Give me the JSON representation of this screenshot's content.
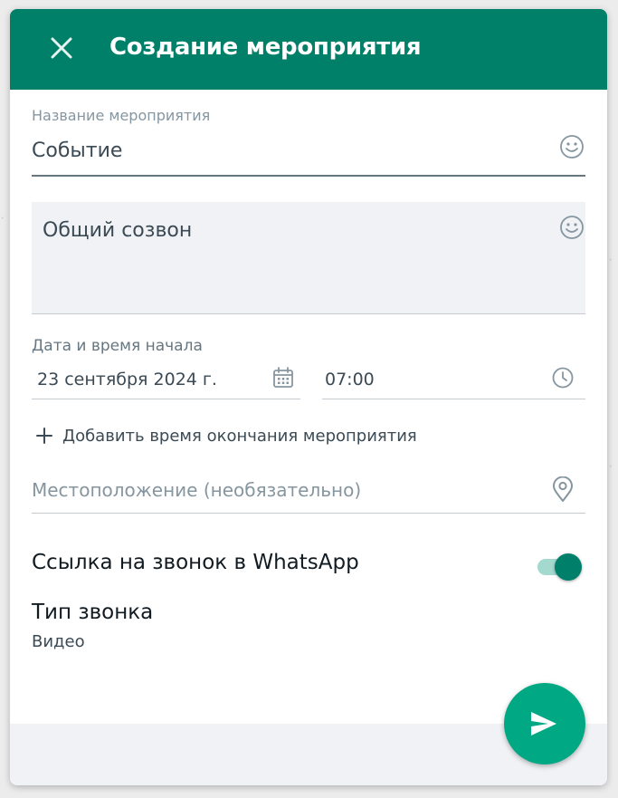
{
  "header": {
    "title": "Создание мероприятия",
    "close_icon": "close-icon",
    "color": "#008069"
  },
  "event_name": {
    "label": "Название мероприятия",
    "value": "Событие",
    "icon": "emoji-icon"
  },
  "description": {
    "value": "Общий созвон",
    "icon": "emoji-icon"
  },
  "start": {
    "label": "Дата и время начала",
    "date": "23 сентября 2024 г.",
    "date_icon": "calendar-icon",
    "time": "07:00",
    "time_icon": "clock-icon"
  },
  "add_end_time": {
    "label": "Добавить время окончания мероприятия",
    "icon": "plus-icon"
  },
  "location": {
    "placeholder": "Местоположение (необязательно)",
    "value": "",
    "icon": "location-pin-icon"
  },
  "whatsapp_call_link": {
    "label": "Ссылка на звонок в WhatsApp",
    "enabled": true
  },
  "call_type": {
    "title": "Тип звонка",
    "value": "Видео"
  },
  "send_button": {
    "icon": "send-icon",
    "color": "#00a884"
  }
}
